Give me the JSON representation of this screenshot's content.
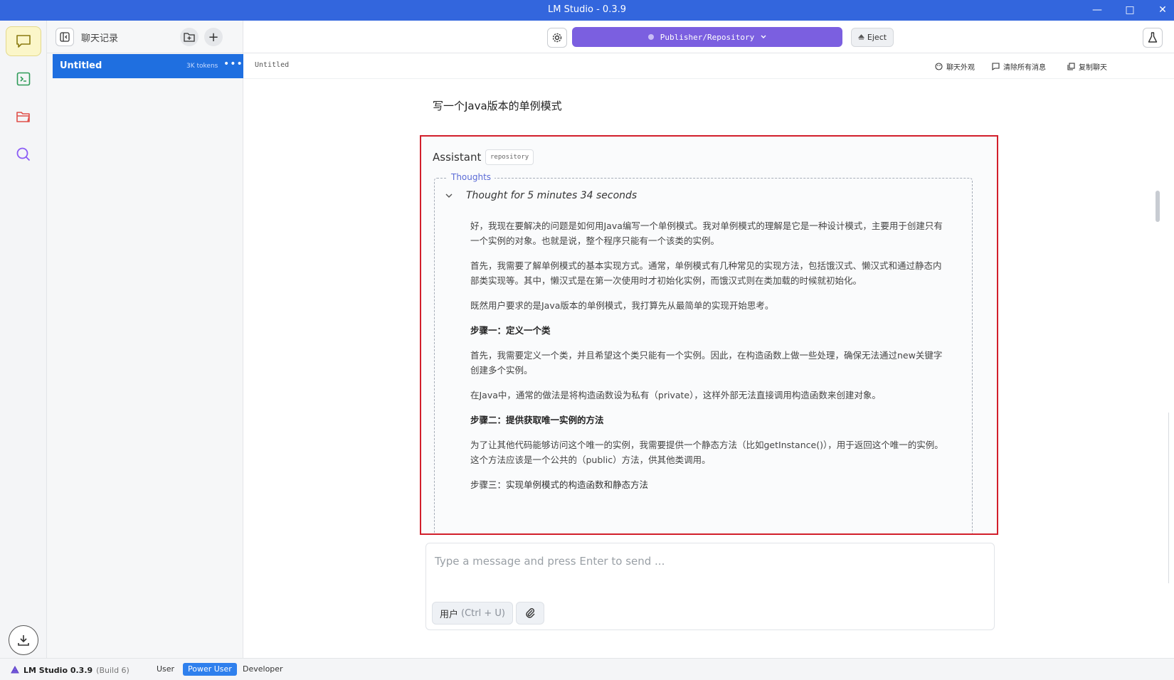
{
  "window": {
    "title": "LM Studio - 0.3.9"
  },
  "chat_list": {
    "title": "聊天记录",
    "items": [
      {
        "name": "Untitled",
        "tokens": "3K tokens"
      }
    ]
  },
  "toolbar": {
    "model_label": "Publisher/Repository",
    "eject_label": "Eject"
  },
  "subheader": {
    "crumb": "Untitled",
    "actions": {
      "appearance": "聊天外观",
      "clear": "清除所有消息",
      "copy": "复制聊天"
    }
  },
  "messages": {
    "user": "写一个Java版本的单例模式",
    "assistant": {
      "name": "Assistant",
      "badge": "repository",
      "thoughts_legend": "Thoughts",
      "thought_time": "Thought for 5 minutes 34 seconds",
      "paragraphs": [
        "好，我现在要解决的问题是如何用Java编写一个单例模式。我对单例模式的理解是它是一种设计模式，主要用于创建只有一个实例的对象。也就是说，整个程序只能有一个该类的实例。",
        "首先，我需要了解单例模式的基本实现方式。通常，单例模式有几种常见的实现方法，包括饿汉式、懒汉式和通过静态内部类实现等。其中，懒汉式是在第一次使用时才初始化实例，而饿汉式则在类加载的时候就初始化。",
        "既然用户要求的是Java版本的单例模式，我打算先从最简单的实现开始思考。",
        "步骤一：定义一个类",
        "首先，我需要定义一个类，并且希望这个类只能有一个实例。因此，在构造函数上做一些处理，确保无法通过new关键字创建多个实例。",
        "在Java中，通常的做法是将构造函数设为私有（private），这样外部无法直接调用构造函数来创建对象。",
        "步骤二：提供获取唯一实例的方法",
        "为了让其他代码能够访问这个唯一的实例，我需要提供一个静态方法（比如getInstance()），用于返回这个唯一的实例。这个方法应该是一个公共的（public）方法，供其他类调用。",
        "步骤三：实现单例模式的构造函数和静态方法"
      ]
    }
  },
  "composer": {
    "placeholder": "Type a message and press Enter to send ...",
    "role_label": "用户",
    "role_hint": "(Ctrl + U)"
  },
  "statusbar": {
    "brand": "LM Studio 0.3.9",
    "build": "(Build 6)",
    "modes": [
      "User",
      "Power User",
      "Developer"
    ],
    "active_mode": "Power User"
  },
  "colors": {
    "accent": "#3366dd",
    "model_button": "#7b5fe0",
    "selected_chat": "#1f6fe0",
    "highlight_border": "#d21f2b"
  }
}
